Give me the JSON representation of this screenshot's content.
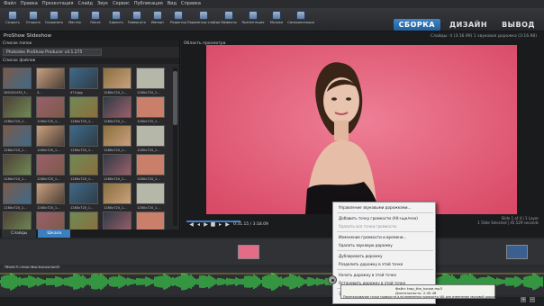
{
  "menu": [
    "Файл",
    "Правка",
    "Презентация",
    "Слайд",
    "Звук",
    "Сервис",
    "Публикация",
    "Вид",
    "Справка"
  ],
  "toolbar": [
    {
      "label": "Создать",
      "icon": "new-icon"
    },
    {
      "label": "Открыть",
      "icon": "open-icon"
    },
    {
      "label": "Сохранить",
      "icon": "save-icon"
    },
    {
      "label": "Мастер",
      "icon": "wizard-icon"
    },
    {
      "label": "Показ",
      "icon": "show-icon"
    },
    {
      "label": "Удалить",
      "icon": "delete-icon"
    },
    {
      "label": "Повернуть",
      "icon": "rotate-icon"
    },
    {
      "label": "Импорт",
      "icon": "import-icon"
    },
    {
      "label": "Редактор",
      "icon": "editor-icon"
    },
    {
      "label": "Параметры слайда",
      "icon": "slide-options-icon"
    },
    {
      "label": "Эффекты",
      "icon": "effects-icon"
    },
    {
      "label": "Презентация",
      "icon": "presentation-icon"
    },
    {
      "label": "Музыка",
      "icon": "music-icon"
    },
    {
      "label": "Синхронизация",
      "icon": "sync-icon"
    }
  ],
  "modes": [
    "СБОРКА",
    "ДИЗАЙН",
    "ВЫВОД"
  ],
  "window_title": "ProShow Slideshow",
  "window_info": "Слайды: 4 (3:16.99)  1 звуковая дорожка (3:16.98)",
  "folders_header": "Список папок",
  "folder_path": "Photodex ProShow Producer v4.1.275",
  "files_header": "Список файлов",
  "files": [
    "2801f41f35_f...",
    "3...",
    "474.jpg",
    "1280x720_1...",
    "1280x720_1...",
    "1280x720_1...",
    "1280x720_1...",
    "1280x720_1...",
    "1280x720_1...",
    "1280x720_1...",
    "1280x720_1...",
    "1280x720_1...",
    "1280x720_1...",
    "1280x720_1...",
    "1280x720_1...",
    "1280x720_1...",
    "1280x720_1...",
    "1280x720_1...",
    "1280x720_1...",
    "1280x720_1...",
    "1280x720_1...",
    "1280x720_1...",
    "1280x720_1...",
    "1280x720_1...",
    "1280x720_1...",
    "1280x720_1...",
    "1280x720_1...",
    "1280x720_1...",
    "1280x720_1...",
    "1280x720_1...",
    "1280x720_1...",
    "1280x720_1...",
    "1280x720_1...",
    "1280x720_1...",
    "1280x720_1..."
  ],
  "preview_header": "Область просмотра",
  "player": {
    "time": "0:31.15 / 3:18.09",
    "slide_info": "Slide 1 of 4  |  1 Layer",
    "selection_info": "1 Slide Selected  |  45.529 seconds"
  },
  "tabs": [
    "Слайды",
    "Шкала"
  ],
  "track_name": "Track 1 - trap_the_house.mp3",
  "context_menu": [
    {
      "label": "Управление звуковыми дорожками...",
      "dim": false
    },
    {
      "label": "Добавить точку громкости (Alt+щелчок)",
      "dim": false
    },
    {
      "label": "Удалить все точки громкости",
      "dim": true
    },
    {
      "label": "Изменение громкости и времени...",
      "dim": false
    },
    {
      "label": "Удалить звуковую дорожку",
      "dim": false
    },
    {
      "label": "Дублировать дорожку",
      "dim": false
    },
    {
      "label": "Разделить дорожку в этой точке",
      "dim": false
    },
    {
      "label": "Начать дорожку в этой точке",
      "dim": false
    },
    {
      "label": "Остановить дорожку в этой точке",
      "dim": false
    },
    {
      "label": "Задержка времени",
      "dim": false
    }
  ],
  "tooltip": {
    "lines": [
      "Файл: trap_the_house.mp3",
      "Длительность: 2:45.46"
    ],
    "note": "Перетаскивание точки громкости для изменения громкости (Alt для изменения звуковой дорожки)"
  }
}
